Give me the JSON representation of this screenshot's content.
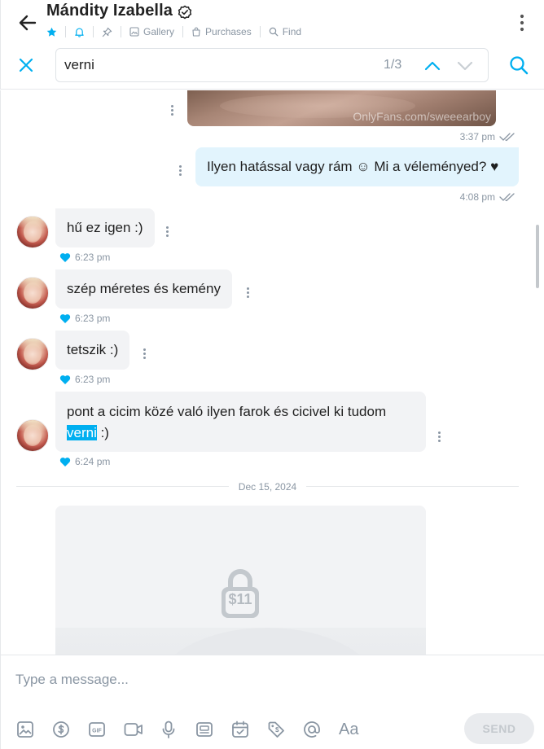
{
  "header": {
    "name": "Mándity Izabella",
    "tabs": [
      {
        "label": "Gallery"
      },
      {
        "label": "Purchases"
      },
      {
        "label": "Find"
      }
    ]
  },
  "search": {
    "query": "verni",
    "counter": "1/3"
  },
  "photo": {
    "watermark": "OnlyFans.com/sweeearboy"
  },
  "messages": [
    {
      "time": "3:37 pm"
    },
    {
      "text": "Ilyen hatással vagy rám ☺ Mi a véleményed? ♥",
      "time": "4:08 pm"
    },
    {
      "text": "hű ez igen :)",
      "time": "6:23 pm"
    },
    {
      "text": "szép méretes és kemény",
      "time": "6:23 pm"
    },
    {
      "text": "tetszik :)",
      "time": "6:23 pm"
    },
    {
      "line1": "pont a cicim közé való ilyen farok és cicivel ki tudom",
      "highlight": "verni",
      "after": " :)",
      "time": "6:24 pm"
    }
  ],
  "date_separator": "Dec 15, 2024",
  "locked_media": {
    "price": "$11"
  },
  "composer": {
    "placeholder": "Type a message...",
    "send_label": "SEND"
  },
  "colors": {
    "accent": "#00aff0",
    "outgoing_bubble": "#e2f4fd",
    "incoming_bubble": "#f2f3f5",
    "muted": "#8a96a3"
  },
  "icons": [
    "back-arrow-icon",
    "verified-icon",
    "star-icon",
    "bell-icon",
    "pin-icon",
    "gallery-icon",
    "purchases-icon",
    "find-icon",
    "more-vertical-icon",
    "close-icon",
    "chevron-up-icon",
    "chevron-down-icon",
    "search-icon",
    "double-check-icon",
    "heart-icon",
    "lock-icon",
    "image-icon",
    "dollar-icon",
    "gif-icon",
    "video-icon",
    "microphone-icon",
    "vault-icon",
    "calendar-icon",
    "price-tag-icon",
    "at-icon",
    "text-format-icon"
  ]
}
